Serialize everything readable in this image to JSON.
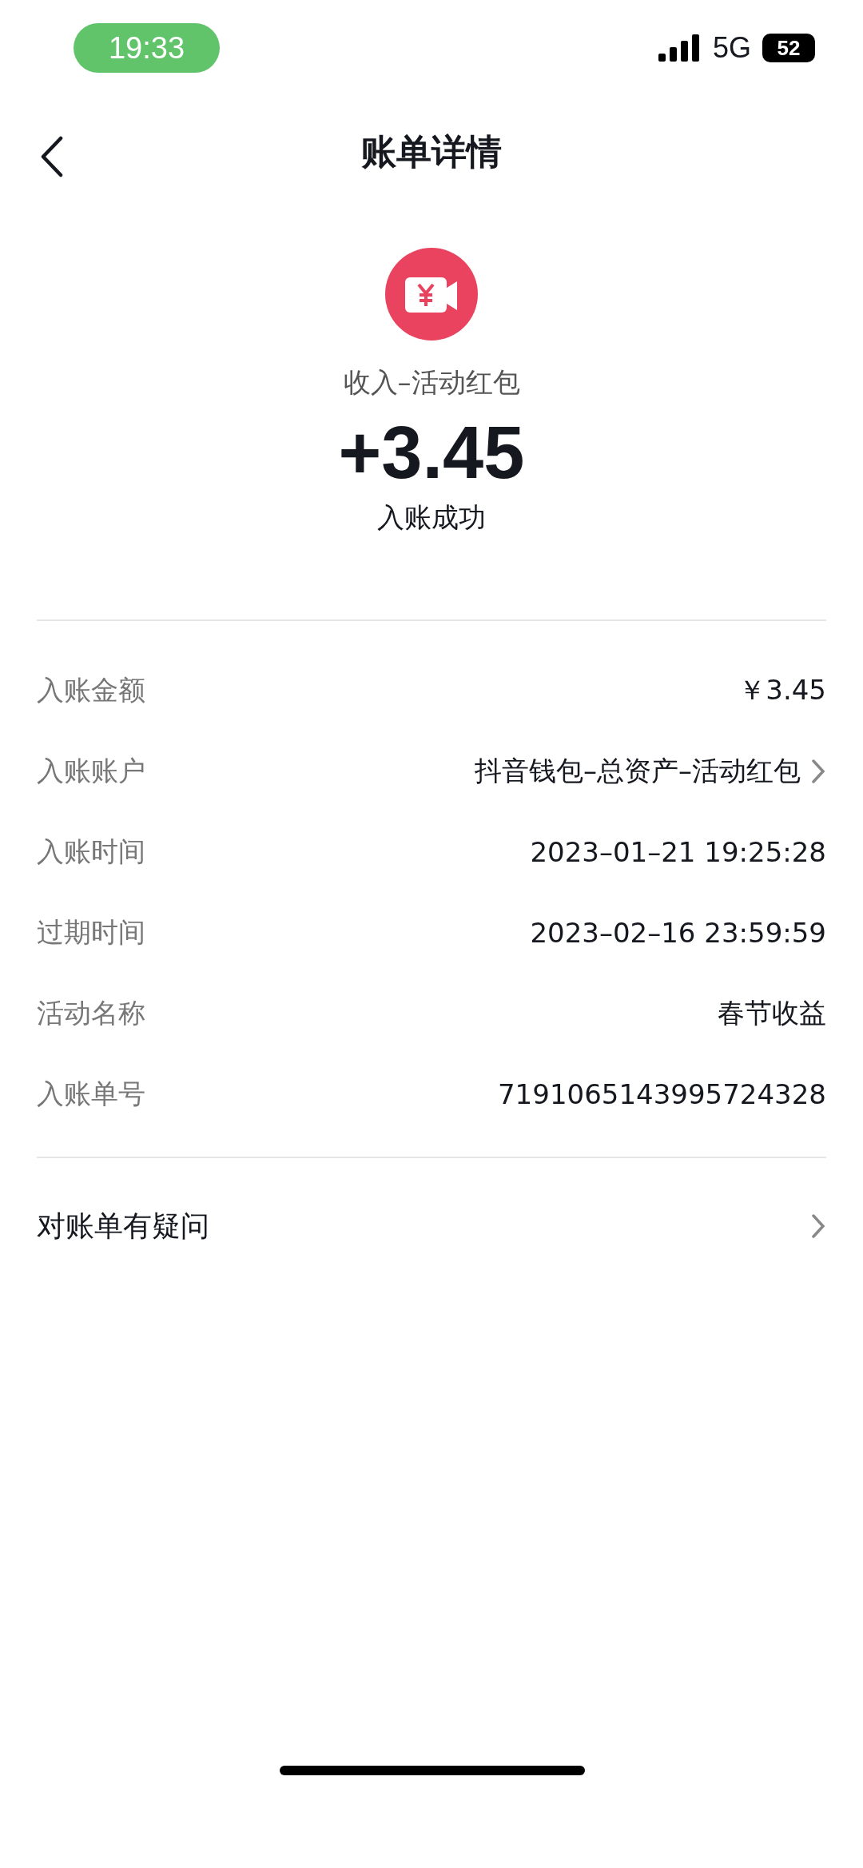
{
  "status_bar": {
    "time": "19:33",
    "network": "5G",
    "battery": "52"
  },
  "nav": {
    "title": "账单详情"
  },
  "summary": {
    "category": "收入–活动红包",
    "amount": "+3.45",
    "status": "入账成功"
  },
  "details": [
    {
      "label": "入账金额",
      "value": "￥3.45",
      "link": false
    },
    {
      "label": "入账账户",
      "value": "抖音钱包–总资产–活动红包",
      "link": true
    },
    {
      "label": "入账时间",
      "value": "2023–01–21 19:25:28",
      "link": false
    },
    {
      "label": "过期时间",
      "value": "2023–02–16 23:59:59",
      "link": false
    },
    {
      "label": "活动名称",
      "value": "春节收益",
      "link": false
    },
    {
      "label": "入账单号",
      "value": "7191065143995724328",
      "link": false
    }
  ],
  "help": {
    "label": "对账单有疑问"
  }
}
